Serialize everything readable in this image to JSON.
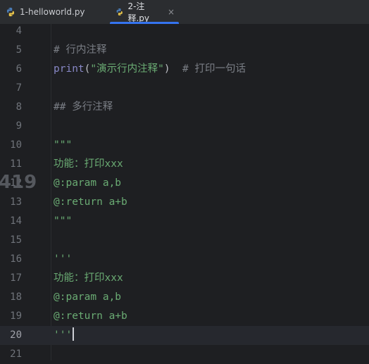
{
  "tabs": [
    {
      "label": "1-helloworld.py",
      "active": false
    },
    {
      "label": "2-注释.py",
      "active": true,
      "close": "×"
    }
  ],
  "colors": {
    "background": "#1e1f22",
    "tab_accent": "#3574f0",
    "comment": "#7a7e85",
    "builtin": "#8888c6",
    "string": "#6aab73"
  },
  "editor": {
    "current_line": "20",
    "overlay_number": "419",
    "lines": [
      {
        "num": "4",
        "tokens": []
      },
      {
        "num": "5",
        "tokens": [
          {
            "t": "comment",
            "v": "# 行内注释"
          }
        ]
      },
      {
        "num": "6",
        "tokens": [
          {
            "t": "builtin",
            "v": "print"
          },
          {
            "t": "paren",
            "v": "("
          },
          {
            "t": "string",
            "v": "\"演示行内注释\""
          },
          {
            "t": "paren",
            "v": ")"
          },
          {
            "t": "comment",
            "v": "  # 打印一句话"
          }
        ]
      },
      {
        "num": "7",
        "tokens": []
      },
      {
        "num": "8",
        "tokens": [
          {
            "t": "comment",
            "v": "## 多行注释"
          }
        ]
      },
      {
        "num": "9",
        "tokens": []
      },
      {
        "num": "10",
        "tokens": [
          {
            "t": "string",
            "v": "\"\"\""
          }
        ]
      },
      {
        "num": "11",
        "tokens": [
          {
            "t": "string",
            "v": "功能：打印xxx"
          }
        ]
      },
      {
        "num": "12",
        "tokens": [
          {
            "t": "string",
            "v": "@:param a,b"
          }
        ]
      },
      {
        "num": "13",
        "tokens": [
          {
            "t": "string",
            "v": "@:return a+b"
          }
        ]
      },
      {
        "num": "14",
        "tokens": [
          {
            "t": "string",
            "v": "\"\"\""
          }
        ]
      },
      {
        "num": "15",
        "tokens": []
      },
      {
        "num": "16",
        "tokens": [
          {
            "t": "string",
            "v": "'''"
          }
        ]
      },
      {
        "num": "17",
        "tokens": [
          {
            "t": "string",
            "v": "功能：打印xxx"
          }
        ]
      },
      {
        "num": "18",
        "tokens": [
          {
            "t": "string",
            "v": "@:param a,b"
          }
        ]
      },
      {
        "num": "19",
        "tokens": [
          {
            "t": "string",
            "v": "@:return a+b"
          }
        ]
      },
      {
        "num": "20",
        "tokens": [
          {
            "t": "string",
            "v": "'''"
          }
        ]
      },
      {
        "num": "21",
        "tokens": []
      }
    ]
  }
}
